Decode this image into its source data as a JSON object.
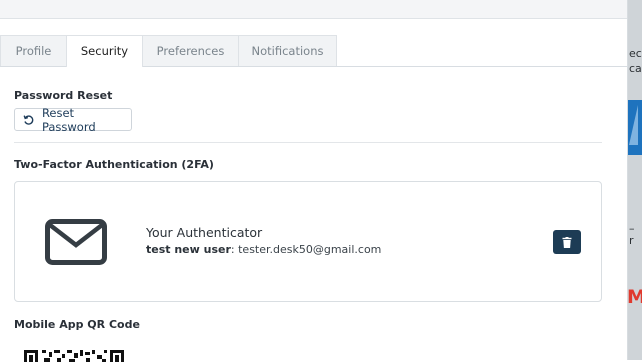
{
  "background": {
    "text_lines": [
      "ect",
      "cat",
      "–",
      "r",
      "MU"
    ]
  },
  "tabs": [
    {
      "label": "Profile",
      "active": false
    },
    {
      "label": "Security",
      "active": true
    },
    {
      "label": "Preferences",
      "active": false
    },
    {
      "label": "Notifications",
      "active": false
    }
  ],
  "password": {
    "section_label": "Password Reset",
    "reset_button_label": "Reset Password",
    "reset_icon": "rotate-ccw-icon"
  },
  "twofa": {
    "section_label": "Two-Factor Authentication (2FA)",
    "method_icon": "envelope-icon",
    "method_name": "Your Authenticator",
    "user_label": "test new user",
    "separator": ": ",
    "user_email": "tester.desk50@gmail.com",
    "delete_icon": "trash-icon"
  },
  "qr": {
    "section_label": "Mobile App QR Code"
  },
  "colors": {
    "accent": "#1d3c55",
    "tab_inactive_bg": "#f1f3f5",
    "border": "#d9dee2"
  }
}
